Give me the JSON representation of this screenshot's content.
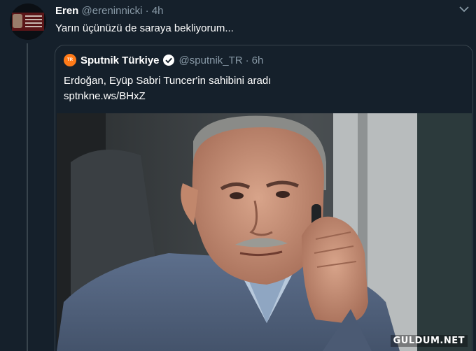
{
  "tweet": {
    "name": "Eren",
    "handle": "@ereninnicki",
    "separator": "·",
    "time": "4h",
    "text": "Yarın üçünüzü de saraya bekliyorum..."
  },
  "quoted": {
    "name": "Sputnik Türkiye",
    "handle": "@sputnik_TR",
    "separator": "·",
    "time": "6h",
    "text": "Erdoğan, Eyüp Sabri Tuncer'in sahibini aradı",
    "link": "sptnkne.ws/BHxZ",
    "logo_text": "TR"
  },
  "watermark": "GULDUM.NET",
  "colors": {
    "background": "#15202b",
    "secondary_text": "#8899a6",
    "border": "#38444d",
    "verified": "#1da1f2",
    "sputnik_orange": "#ff7a18"
  },
  "icons": {
    "caret": "chevron-down-icon",
    "verified": "verified-badge-icon"
  }
}
